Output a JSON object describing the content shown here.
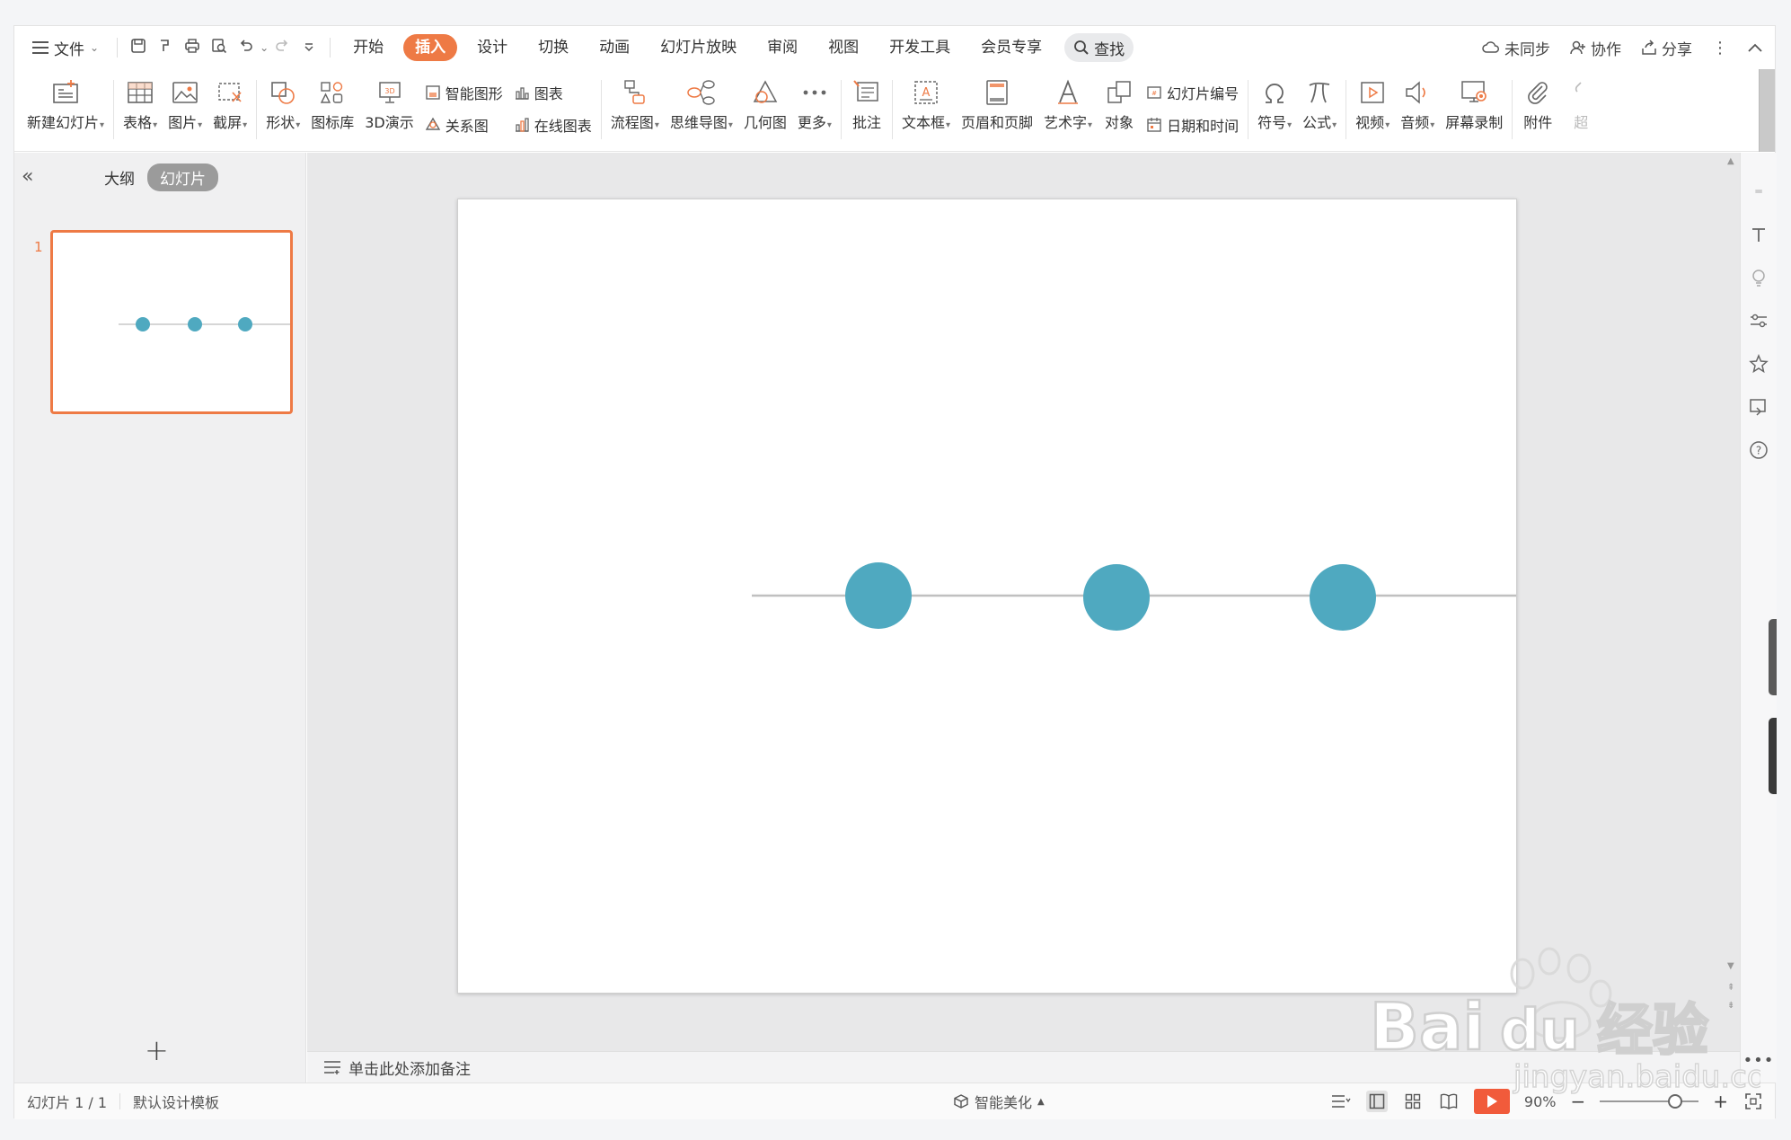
{
  "menu": {
    "file_label": "文件",
    "tabs": [
      "开始",
      "插入",
      "设计",
      "切换",
      "动画",
      "幻灯片放映",
      "审阅",
      "视图",
      "开发工具",
      "会员专享"
    ],
    "active_tab": "插入",
    "search_label": "查找",
    "right": {
      "sync_label": "未同步",
      "collab_label": "协作",
      "share_label": "分享"
    }
  },
  "ribbon": {
    "new_slide": "新建幻灯片",
    "table": "表格",
    "picture": "图片",
    "screenshot": "截屏",
    "shape": "形状",
    "icon_library": "图标库",
    "demo_3d": "3D演示",
    "smart_art": "智能图形",
    "relation": "关系图",
    "chart": "图表",
    "online_chart": "在线图表",
    "flowchart": "流程图",
    "mindmap": "思维导图",
    "geometry": "几何图",
    "more": "更多",
    "comment": "批注",
    "textbox": "文本框",
    "header_footer": "页眉和页脚",
    "wordart": "艺术字",
    "object": "对象",
    "slide_number": "幻灯片编号",
    "date_time": "日期和时间",
    "symbol": "符号",
    "formula": "公式",
    "video": "视频",
    "audio": "音频",
    "screen_record": "屏幕录制",
    "attachment": "附件",
    "hyperlink_partial": "超"
  },
  "left_panel": {
    "outline_tab": "大纲",
    "slides_tab": "幻灯片",
    "slide_number": "1"
  },
  "notes_placeholder": "单击此处添加备注",
  "status": {
    "slide_count": "幻灯片 1 / 1",
    "template": "默认设计模板",
    "beautify": "智能美化",
    "zoom": "90%"
  },
  "colors": {
    "accent": "#ee7a45",
    "circle": "#4fa9c0",
    "line": "#c8c8c8",
    "play": "#f15b3b"
  }
}
